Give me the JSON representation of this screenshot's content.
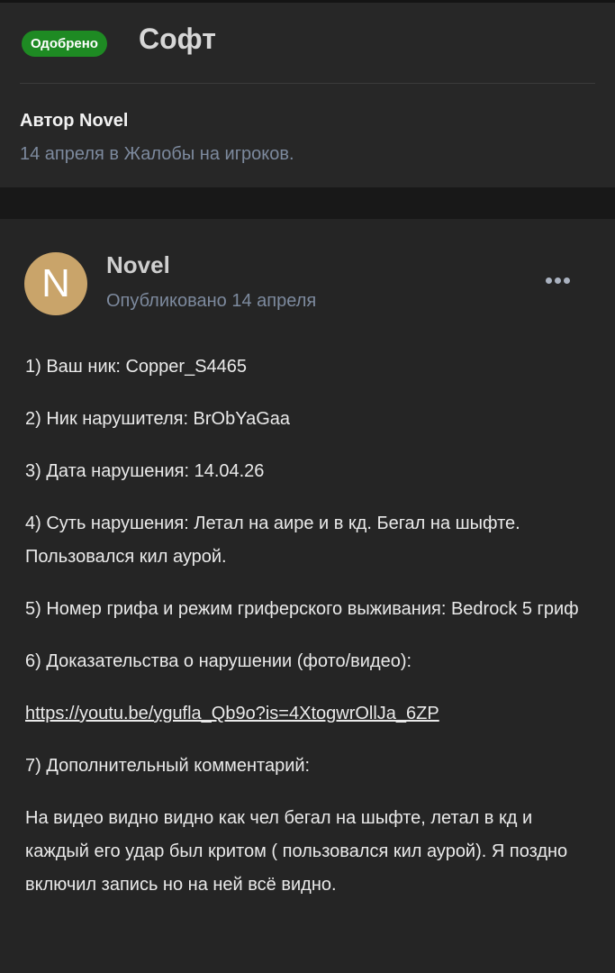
{
  "header": {
    "badge": "Одобрено",
    "title": "Софт",
    "author_line": "Автор Novel",
    "meta_line": "14 апреля в Жалобы на игроков."
  },
  "post": {
    "avatar_letter": "N",
    "author": "Novel",
    "published": "Опубликовано 14 апреля",
    "menu_icon": "more-dots-icon",
    "lines": {
      "l1": "1) Ваш ник: Copper_S4465",
      "l2": "2) Ник нарушителя: BrObYaGaa",
      "l3": "3) Дата нарушения: 14.04.26",
      "l4": "4) Суть нарушения: Летал на аире и в кд. Бегал на шыфте. Пользовался кил аурой.",
      "l5": "5) Номер грифа и режим гриферского выживания: Bedrock 5 гриф",
      "l6": "6) Доказательства о нарушении (фото/видео):",
      "link": "https://youtu.be/ygufla_Qb9o?is=4XtogwrOllJa_6ZP",
      "l7": "7) Дополнительный комментарий:",
      "comment": "На видео видно видно как чел бегал на шыфте, летал в кд и каждый его удар был критом ( пользовался кил аурой). Я поздно включил запись но на ней всё видно."
    }
  },
  "colors": {
    "badge_green": "#1e8a23",
    "meta_blue_gray": "#7d8a9e",
    "avatar_gold": "#c9a46a",
    "background": "#1e1e1e"
  }
}
